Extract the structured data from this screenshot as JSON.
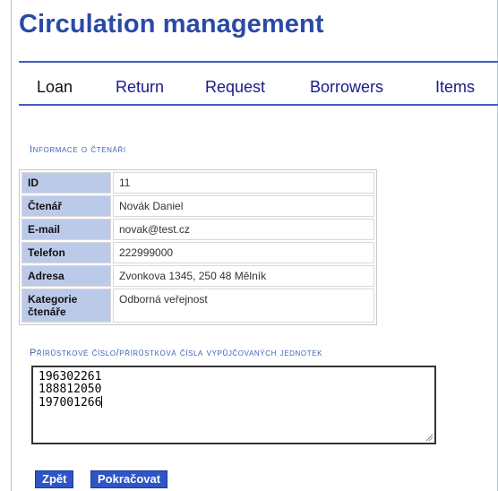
{
  "page": {
    "title": "Circulation management"
  },
  "nav": {
    "items": [
      {
        "label": "Loan"
      },
      {
        "label": "Return"
      },
      {
        "label": "Request"
      },
      {
        "label": "Borrowers"
      },
      {
        "label": "Items"
      }
    ]
  },
  "reader_info": {
    "heading": "Informace o čtenáři",
    "rows": [
      {
        "label": "ID",
        "value": "11"
      },
      {
        "label": "Čtenář",
        "value": "Novák Daniel"
      },
      {
        "label": "E-mail",
        "value": "novak@test.cz"
      },
      {
        "label": "Telefon",
        "value": "222999000"
      },
      {
        "label": "Adresa",
        "value": "Zvonkova 1345, 250 48 Mělník"
      },
      {
        "label": "Kategorie čtenáře",
        "value": "Odborná veřejnost"
      }
    ]
  },
  "items_input": {
    "heading": "Přírůstkové číslo/přírůstková čísla vypůjčovaných jednotek",
    "lines": [
      "196302261",
      "188812050",
      "197001266"
    ]
  },
  "buttons": {
    "back_label": "Zpět",
    "continue_label": "Pokračovat"
  },
  "colors": {
    "title": "#2a4aa8",
    "nav_border": "#3d5ec0",
    "label_cell_bg": "#bccaea",
    "button_bg": "#2f55c4",
    "section_heading": "#3f63b8"
  }
}
